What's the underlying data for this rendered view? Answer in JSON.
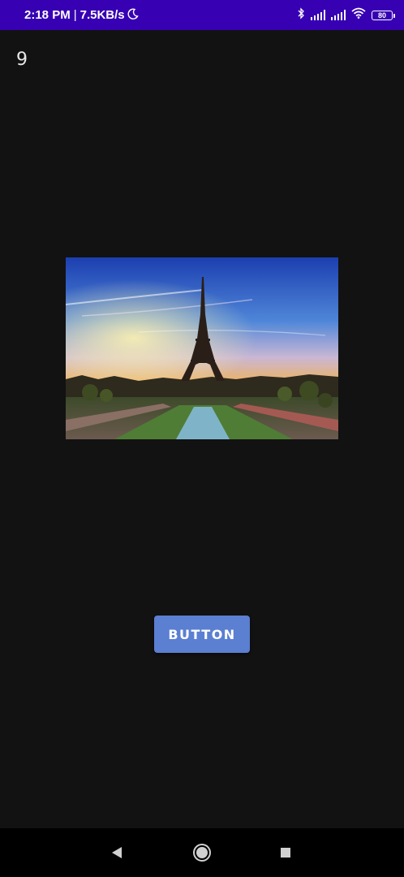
{
  "status_bar": {
    "time": "2:18 PM",
    "speed": "7.5KB/s",
    "battery_level": "80",
    "icons": [
      "moon-icon",
      "bluetooth-icon",
      "signal-icon",
      "signal-icon",
      "wifi-icon",
      "battery-icon"
    ]
  },
  "main": {
    "counter": "9",
    "image": {
      "subject": "eiffel-tower-photo"
    },
    "button_label": "BUTTON"
  },
  "nav_bar": {
    "icons": [
      "back-icon",
      "home-icon",
      "recents-icon"
    ]
  },
  "colors": {
    "status_bar_bg": "#3700b3",
    "background": "#121212",
    "button_bg": "#5b7fd1",
    "nav_bar_bg": "#000000"
  }
}
